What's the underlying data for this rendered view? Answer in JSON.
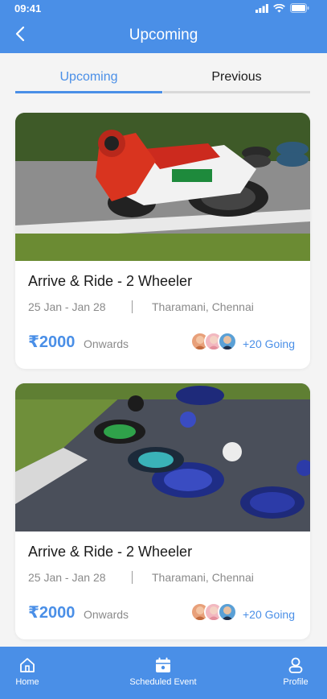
{
  "status": {
    "time": "09:41"
  },
  "header": {
    "title": "Upcoming"
  },
  "tabs": [
    {
      "label": "Upcoming"
    },
    {
      "label": "Previous"
    }
  ],
  "events": [
    {
      "title": "Arrive & Ride - 2 Wheeler",
      "dates": "25 Jan - Jan 28",
      "location": "Tharamani, Chennai",
      "price": "₹2000",
      "price_suffix": "Onwards",
      "going": "+20 Going"
    },
    {
      "title": "Arrive & Ride - 2 Wheeler",
      "dates": "25 Jan - Jan 28",
      "location": "Tharamani, Chennai",
      "price": "₹2000",
      "price_suffix": "Onwards",
      "going": "+20 Going"
    }
  ],
  "nav": [
    {
      "label": "Home",
      "icon": "home-icon"
    },
    {
      "label": "Scheduled Event",
      "icon": "calendar-icon"
    },
    {
      "label": "Profile",
      "icon": "profile-icon"
    }
  ],
  "colors": {
    "accent": "#4a8fe7",
    "background": "#f4f4f4"
  }
}
